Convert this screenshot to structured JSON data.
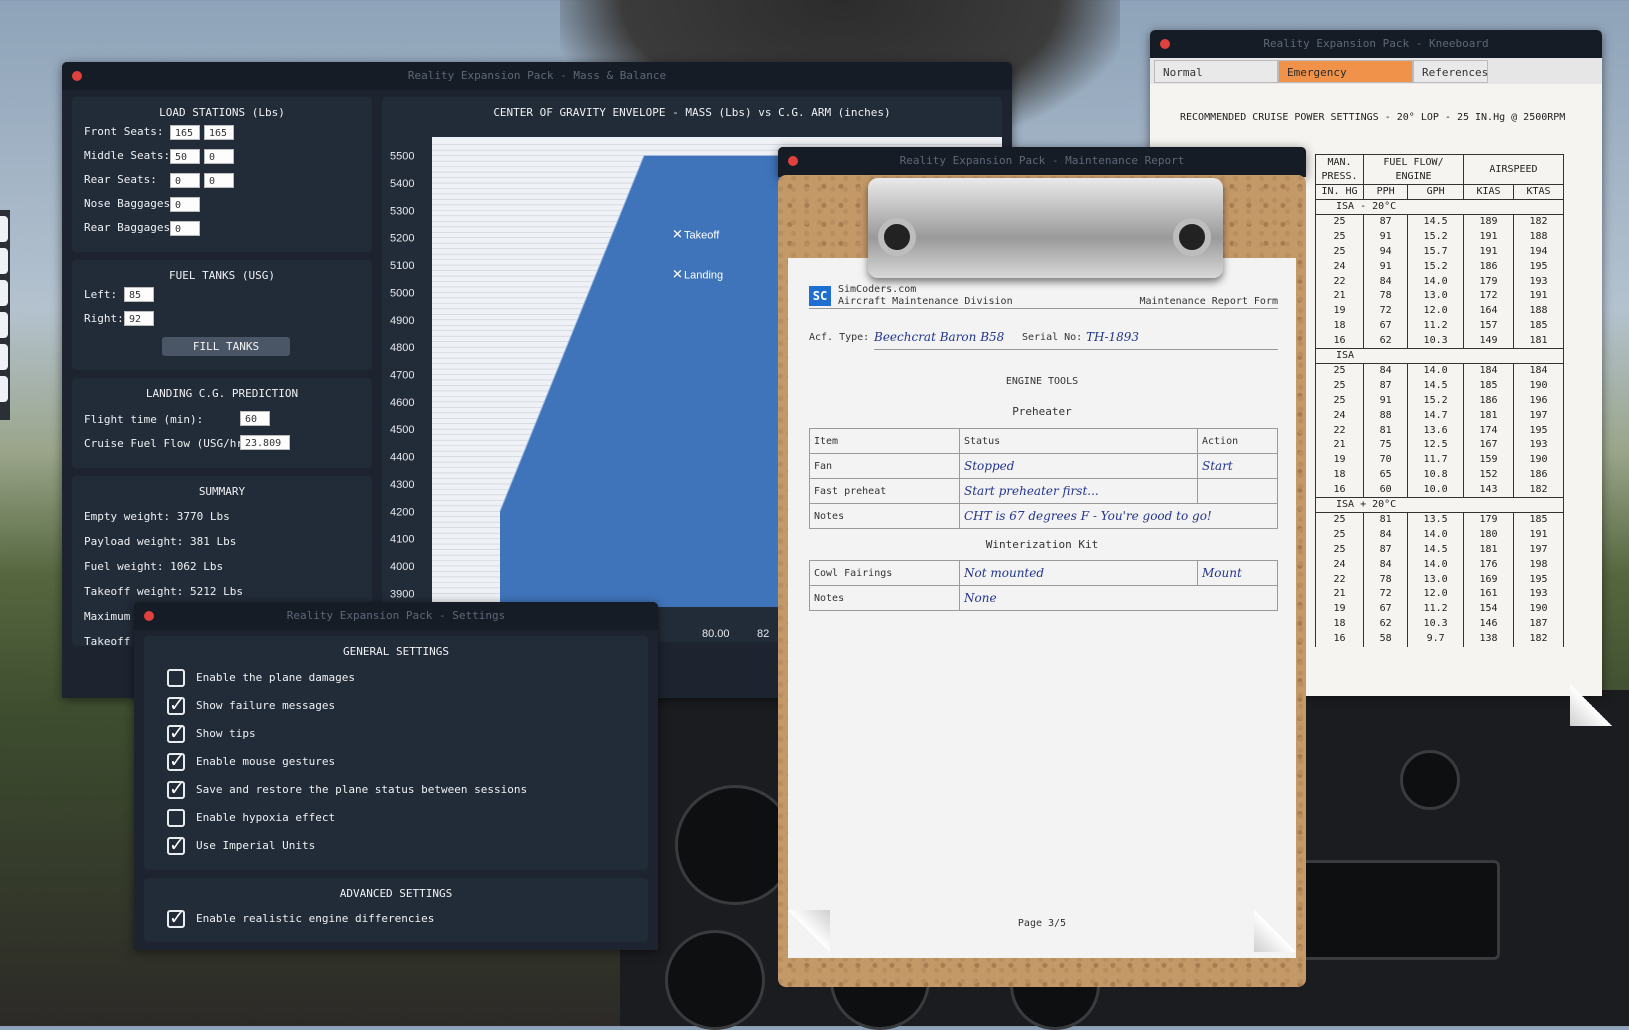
{
  "mass_balance": {
    "title": "Reality Expansion Pack - Mass & Balance",
    "load_stations": {
      "title": "LOAD STATIONS (Lbs)",
      "rows": [
        {
          "label": "Front Seats:",
          "v1": "165",
          "v2": "165"
        },
        {
          "label": "Middle Seats:",
          "v1": "50",
          "v2": "0"
        },
        {
          "label": "Rear Seats:",
          "v1": "0",
          "v2": "0"
        },
        {
          "label": "Nose Baggages:",
          "v1": "0"
        },
        {
          "label": "Rear Baggages:",
          "v1": "0"
        }
      ]
    },
    "fuel_tanks": {
      "title": "FUEL TANKS (USG)",
      "left_label": "Left:",
      "left": "85",
      "right_label": "Right:",
      "right": "92",
      "fill_button": "FILL TANKS"
    },
    "landing": {
      "title": "LANDING C.G. PREDICTION",
      "flight_time_label": "Flight time (min):",
      "flight_time": "60",
      "cruise_label": "Cruise Fuel Flow (USG/hr):",
      "cruise": "23.809"
    },
    "summary": {
      "title": "SUMMARY",
      "lines": [
        "Empty weight: 3770 Lbs",
        "Payload weight: 381 Lbs",
        "Fuel weight: 1062 Lbs",
        "Takeoff weight: 5212 Lbs",
        "Maximum t",
        "Takeoff C"
      ]
    }
  },
  "chart_data": {
    "type": "area",
    "title": "CENTER OF GRAVITY ENVELOPE - MASS (Lbs) vs C.G. ARM (inches)",
    "y_ticks": [
      5500,
      5400,
      5300,
      5200,
      5100,
      5000,
      4900,
      4800,
      4700,
      4600,
      4500,
      4400,
      4300,
      4200,
      4100,
      4000,
      3900
    ],
    "x_ticks": [
      "80.00",
      "82"
    ],
    "ylim": [
      3850,
      5550
    ],
    "envelope_left": [
      {
        "y": 4200
      },
      {
        "y": 5500
      }
    ],
    "points": [
      {
        "name": "Takeoff",
        "y": 5212
      },
      {
        "name": "Landing",
        "y": 5065
      }
    ]
  },
  "settings": {
    "title": "Reality Expansion Pack - Settings",
    "general_title": "GENERAL SETTINGS",
    "items": [
      {
        "label": "Enable the plane damages",
        "checked": false
      },
      {
        "label": "Show failure messages",
        "checked": true
      },
      {
        "label": "Show tips",
        "checked": true
      },
      {
        "label": "Enable mouse gestures",
        "checked": true
      },
      {
        "label": "Save and restore the plane status between sessions",
        "checked": true
      },
      {
        "label": "Enable hypoxia effect",
        "checked": false
      },
      {
        "label": "Use Imperial Units",
        "checked": true
      }
    ],
    "advanced_title": "ADVANCED SETTINGS",
    "advanced_items": [
      {
        "label": "Enable realistic engine differencies",
        "checked": true
      }
    ]
  },
  "kneeboard": {
    "title": "Reality Expansion Pack - Kneeboard",
    "tabs": [
      "Normal Operations",
      "Emergency Procedures",
      "References"
    ],
    "active_tab": "Emergency Procedures",
    "heading": "RECOMMENDED CRUISE POWER SETTINGS - 20° LOP - 25 IN.Hg @ 2500RPM",
    "h1": [
      "MAN. PRESS.",
      "FUEL FLOW/ ENGINE",
      "AIRSPEED"
    ],
    "h2": [
      "IN. HG",
      "PPH",
      "GPH",
      "KIAS",
      "KTAS"
    ],
    "sections": [
      {
        "name": "ISA - 20°C",
        "rows": [
          [
            "25",
            "87",
            "14.5",
            "189",
            "182"
          ],
          [
            "25",
            "91",
            "15.2",
            "191",
            "188"
          ],
          [
            "25",
            "94",
            "15.7",
            "191",
            "194"
          ],
          [
            "24",
            "91",
            "15.2",
            "186",
            "195"
          ],
          [
            "22",
            "84",
            "14.0",
            "179",
            "193"
          ],
          [
            "21",
            "78",
            "13.0",
            "172",
            "191"
          ],
          [
            "19",
            "72",
            "12.0",
            "164",
            "188"
          ],
          [
            "18",
            "67",
            "11.2",
            "157",
            "185"
          ],
          [
            "16",
            "62",
            "10.3",
            "149",
            "181"
          ]
        ]
      },
      {
        "name": "ISA",
        "rows": [
          [
            "25",
            "84",
            "14.0",
            "184",
            "184"
          ],
          [
            "25",
            "87",
            "14.5",
            "185",
            "190"
          ],
          [
            "25",
            "91",
            "15.2",
            "186",
            "196"
          ],
          [
            "24",
            "88",
            "14.7",
            "181",
            "197"
          ],
          [
            "22",
            "81",
            "13.6",
            "174",
            "195"
          ],
          [
            "21",
            "75",
            "12.5",
            "167",
            "193"
          ],
          [
            "19",
            "70",
            "11.7",
            "159",
            "190"
          ],
          [
            "18",
            "65",
            "10.8",
            "152",
            "186"
          ],
          [
            "16",
            "60",
            "10.0",
            "143",
            "182"
          ]
        ]
      },
      {
        "name": "ISA + 20°C",
        "rows": [
          [
            "25",
            "81",
            "13.5",
            "179",
            "185"
          ],
          [
            "25",
            "84",
            "14.0",
            "180",
            "191"
          ],
          [
            "25",
            "87",
            "14.5",
            "181",
            "197"
          ],
          [
            "24",
            "84",
            "14.0",
            "176",
            "198"
          ],
          [
            "22",
            "78",
            "13.0",
            "169",
            "195"
          ],
          [
            "21",
            "72",
            "12.0",
            "161",
            "193"
          ],
          [
            "19",
            "67",
            "11.2",
            "154",
            "190"
          ],
          [
            "18",
            "62",
            "10.3",
            "146",
            "187"
          ],
          [
            "16",
            "58",
            "9.7",
            "138",
            "182"
          ]
        ]
      }
    ]
  },
  "maintenance": {
    "title": "Reality Expansion Pack - Maintenance Report",
    "logo": "SC",
    "company": "SimCoders.com",
    "division": "Aircraft Maintenance Division",
    "form": "Maintenance Report Form",
    "acf_label": "Acf. Type:",
    "acf": "Beechcrat Baron B58",
    "serial_label": "Serial No:",
    "serial": "TH-1893",
    "section": "ENGINE TOOLS",
    "preheater": "Preheater",
    "pre_header": {
      "item": "Item",
      "status": "Status",
      "action": "Action"
    },
    "pre_rows": [
      {
        "item": "Fan",
        "status": "Stopped",
        "action": "Start"
      },
      {
        "item": "Fast preheat",
        "status": "Start preheater first...",
        "action": ""
      },
      {
        "item": "Notes",
        "status": "CHT is 67 degrees F - You're good to go!"
      }
    ],
    "winter": "Winterization Kit",
    "winter_rows": [
      {
        "item": "Cowl Fairings",
        "status": "Not mounted",
        "action": "Mount"
      },
      {
        "item": "Notes",
        "status": "None"
      }
    ],
    "page": "Page 3/5"
  }
}
